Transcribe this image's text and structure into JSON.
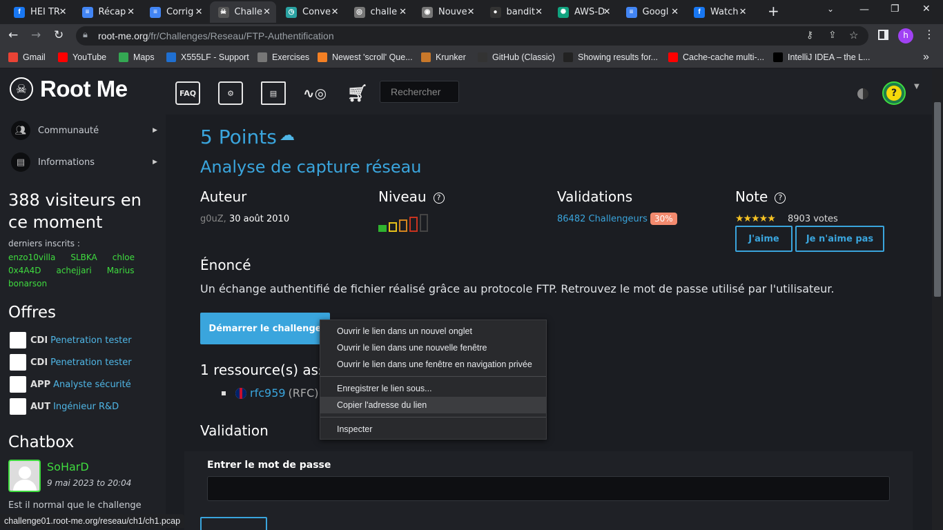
{
  "browser": {
    "tabs": [
      {
        "title": "HEI TR",
        "icon": "facebook-icon",
        "color": "#1877f2",
        "glyph": "f"
      },
      {
        "title": "Récap",
        "icon": "google-docs-icon",
        "color": "#4285f4",
        "glyph": "≡"
      },
      {
        "title": "Corrig",
        "icon": "google-docs-icon",
        "color": "#4285f4",
        "glyph": "≡"
      },
      {
        "title": "Challe",
        "icon": "rootme-icon",
        "color": "#555555",
        "glyph": "☠"
      },
      {
        "title": "Conve",
        "icon": "clock-icon",
        "color": "#2aa2a2",
        "glyph": "◷"
      },
      {
        "title": "challe",
        "icon": "globe-icon",
        "color": "#777777",
        "glyph": "◎"
      },
      {
        "title": "Nouve",
        "icon": "chrome-icon",
        "color": "#777777",
        "glyph": "◉"
      },
      {
        "title": "bandit",
        "icon": "github-icon",
        "color": "#333333",
        "glyph": "●"
      },
      {
        "title": "AWS-D",
        "icon": "chatgpt-icon",
        "color": "#10a37f",
        "glyph": "✺"
      },
      {
        "title": "Googl",
        "icon": "google-docs-icon",
        "color": "#4285f4",
        "glyph": "≡"
      },
      {
        "title": "Watch",
        "icon": "facebook-icon",
        "color": "#1877f2",
        "glyph": "f"
      }
    ],
    "new_tab": "+",
    "url_host": "root-me.org",
    "url_path": "/fr/Challenges/Reseau/FTP-Authentification",
    "profile_letter": "h",
    "bookmarks": [
      {
        "label": "Gmail",
        "icon": "gmail-icon",
        "color": "#ea4335"
      },
      {
        "label": "YouTube",
        "icon": "youtube-icon",
        "color": "#ff0000"
      },
      {
        "label": "Maps",
        "icon": "maps-icon",
        "color": "#34a853"
      },
      {
        "label": "X555LF - Support",
        "icon": "asus-icon",
        "color": "#1f6fd1"
      },
      {
        "label": "Exercises",
        "icon": "globe-icon",
        "color": "#777777"
      },
      {
        "label": "Newest 'scroll' Que...",
        "icon": "stackoverflow-icon",
        "color": "#f48024"
      },
      {
        "label": "Krunker",
        "icon": "krunker-icon",
        "color": "#c8782a"
      },
      {
        "label": "GitHub (Classic)",
        "icon": "github-icon",
        "color": "#333333"
      },
      {
        "label": "Showing results for...",
        "icon": "nu-icon",
        "color": "#222222"
      },
      {
        "label": "Cache-cache multi-...",
        "icon": "youtube-icon",
        "color": "#ff0000"
      },
      {
        "label": "IntelliJ IDEA – the L...",
        "icon": "intellij-icon",
        "color": "#000000"
      }
    ],
    "more_bookmarks": "»"
  },
  "sidebar": {
    "logo": "Root Me",
    "nav": [
      {
        "label": "Communauté",
        "icon": "community-icon"
      },
      {
        "label": "Informations",
        "icon": "info-icon"
      }
    ],
    "visitors": "388 visiteurs en ce moment",
    "recent_label": "derniers inscrits :",
    "recent_users": [
      "enzo10villa",
      "SLBKA",
      "chloe",
      "0x4A4D",
      "achejjari",
      "Marius",
      "bonarson"
    ],
    "offers_title": "Offres",
    "offers": [
      {
        "type": "CDI",
        "title": "Penetration tester"
      },
      {
        "type": "CDI",
        "title": "Penetration tester"
      },
      {
        "type": "APP",
        "title": "Analyste sécurité"
      },
      {
        "type": "AUT",
        "title": "Ingénieur R&D"
      }
    ],
    "chatbox_title": "Chatbox",
    "chat_user": "SoHarD",
    "chat_date": "9 mai 2023 to 20:04",
    "chat_msg": "Est il normal que le challenge"
  },
  "header": {
    "search_placeholder": "Rechercher",
    "icons": [
      "faq-icon",
      "challenges-icon",
      "documentation-icon",
      "radar-icon",
      "shop-icon"
    ]
  },
  "challenge": {
    "points": "5 Points",
    "subtitle": "Analyse de capture réseau",
    "author_h": "Auteur",
    "niveau_h": "Niveau",
    "validations_h": "Validations",
    "note_h": "Note",
    "author": "g0uZ,",
    "date": "30 août 2010",
    "validations": "86482 Challengeurs",
    "validation_pct": "30%",
    "stars": "★★★★★",
    "votes": "8903 votes",
    "like": "J'aime",
    "dislike": "Je n'aime pas",
    "enonce_h": "Énoncé",
    "description": "Un échange authentifié de fichier réalisé grâce au protocole FTP. Retrouvez le mot de passe utilisé par l'utilisateur.",
    "start": "Démarrer le challenge",
    "resources": "1 ressource(s) associée(s)",
    "resource_link": "rfc959",
    "resource_note": "(RFC)",
    "validation_h": "Validation",
    "password_label": "Entrer le mot de passe",
    "level": {
      "value": 1,
      "max": 5
    }
  },
  "context_menu": {
    "items": [
      "Ouvrir le lien dans un nouvel onglet",
      "Ouvrir le lien dans une nouvelle fenêtre",
      "Ouvrir le lien dans une fenêtre en navigation privée",
      "Enregistrer le lien sous...",
      "Copier l'adresse du lien",
      "Inspecter"
    ]
  },
  "status_bar": "challenge01.root-me.org/reseau/ch1/ch1.pcap"
}
